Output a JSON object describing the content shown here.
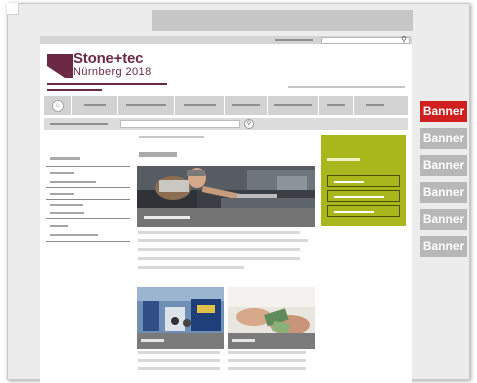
{
  "brand": {
    "name": "Stone+tec",
    "edition": "Nürnberg 2018",
    "color": "#6b2946"
  },
  "header": {
    "search_icon": "search-icon"
  },
  "navigation": {
    "home_icon": "home-icon",
    "item_count": 7
  },
  "breadcrumb": {
    "search_button_icon": "search-icon"
  },
  "sidebar": {
    "link_count": 9
  },
  "main": {
    "hero_image": "craftsman-carving-stone",
    "teasers": [
      "trade-fair-hall",
      "hands-with-samples"
    ]
  },
  "promo_box": {
    "color": "#a9b61c",
    "button_count": 3
  },
  "banners": [
    {
      "label": "Banner",
      "state": "active",
      "color": "#cf1f1f"
    },
    {
      "label": "Banner",
      "state": "inactive",
      "color": "#b7b7b7"
    },
    {
      "label": "Banner",
      "state": "inactive",
      "color": "#b7b7b7"
    },
    {
      "label": "Banner",
      "state": "inactive",
      "color": "#b7b7b7"
    },
    {
      "label": "Banner",
      "state": "inactive",
      "color": "#b7b7b7"
    },
    {
      "label": "Banner",
      "state": "inactive",
      "color": "#b7b7b7"
    }
  ]
}
